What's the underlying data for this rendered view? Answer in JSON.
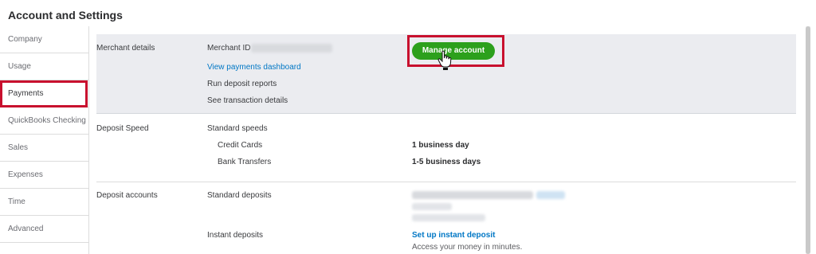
{
  "header": {
    "title": "Account and Settings"
  },
  "sidebar": {
    "items": [
      {
        "label": "Company"
      },
      {
        "label": "Usage"
      },
      {
        "label": "Payments"
      },
      {
        "label": "QuickBooks Checking"
      },
      {
        "label": "Sales"
      },
      {
        "label": "Expenses"
      },
      {
        "label": "Time"
      },
      {
        "label": "Advanced"
      }
    ],
    "active_index": 2
  },
  "merchant": {
    "section_label": "Merchant details",
    "merchant_id_label": "Merchant ID",
    "links": [
      "View payments dashboard"
    ],
    "items": [
      "Run deposit reports",
      "See transaction details"
    ],
    "manage_button": "Manage account"
  },
  "deposit_speed": {
    "section_label": "Deposit Speed",
    "heading": "Standard speeds",
    "rows": [
      {
        "label": "Credit Cards",
        "value": "1 business day"
      },
      {
        "label": "Bank Transfers",
        "value": "1-5 business days"
      }
    ]
  },
  "deposit_accounts": {
    "section_label": "Deposit accounts",
    "standard_label": "Standard deposits",
    "instant_label": "Instant deposits",
    "instant_link": "Set up instant deposit",
    "instant_note": "Access your money in minutes."
  },
  "colors": {
    "accent_green": "#2ca01c",
    "link_blue": "#0077c5",
    "highlight_red": "#c8102e",
    "section_bg": "#ebecf0"
  }
}
